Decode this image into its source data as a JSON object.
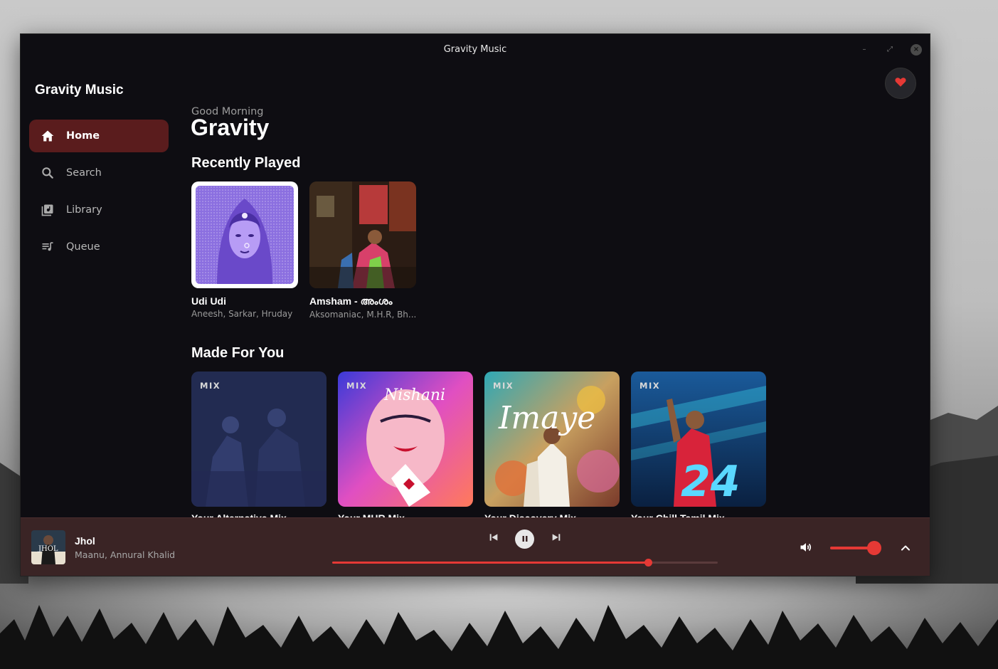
{
  "window": {
    "title": "Gravity Music"
  },
  "sidebar": {
    "app_title": "Gravity Music",
    "items": [
      {
        "label": "Home",
        "icon": "home-icon",
        "active": true
      },
      {
        "label": "Search",
        "icon": "search-icon",
        "active": false
      },
      {
        "label": "Library",
        "icon": "library-icon",
        "active": false
      },
      {
        "label": "Queue",
        "icon": "queue-icon",
        "active": false
      }
    ]
  },
  "header": {
    "greeting": "Good Morning",
    "username": "Gravity"
  },
  "recently_played": {
    "title": "Recently Played",
    "items": [
      {
        "title": "Udi Udi",
        "artists": "Aneesh, Sarkar, Hruday"
      },
      {
        "title": "Amsham - അംശം",
        "artists": "Aksomaniac, M.H.R, Bh..."
      }
    ]
  },
  "made_for_you": {
    "title": "Made For You",
    "badge": "MIX",
    "items": [
      {
        "title": "Your Alternative Mix"
      },
      {
        "title": "Your MHR Mix"
      },
      {
        "title": "Your Discovery Mix"
      },
      {
        "title": "Your Chill Tamil Mix"
      }
    ]
  },
  "player": {
    "track_title": "Jhol",
    "track_artists": "Maanu, Annural Khalid",
    "state": "playing",
    "progress": 0.82,
    "volume": 1.0
  },
  "colors": {
    "accent": "#e53935",
    "active_nav": "#5a1c1d",
    "player_bg": "#3a2425",
    "window_bg": "#0e0d12"
  }
}
